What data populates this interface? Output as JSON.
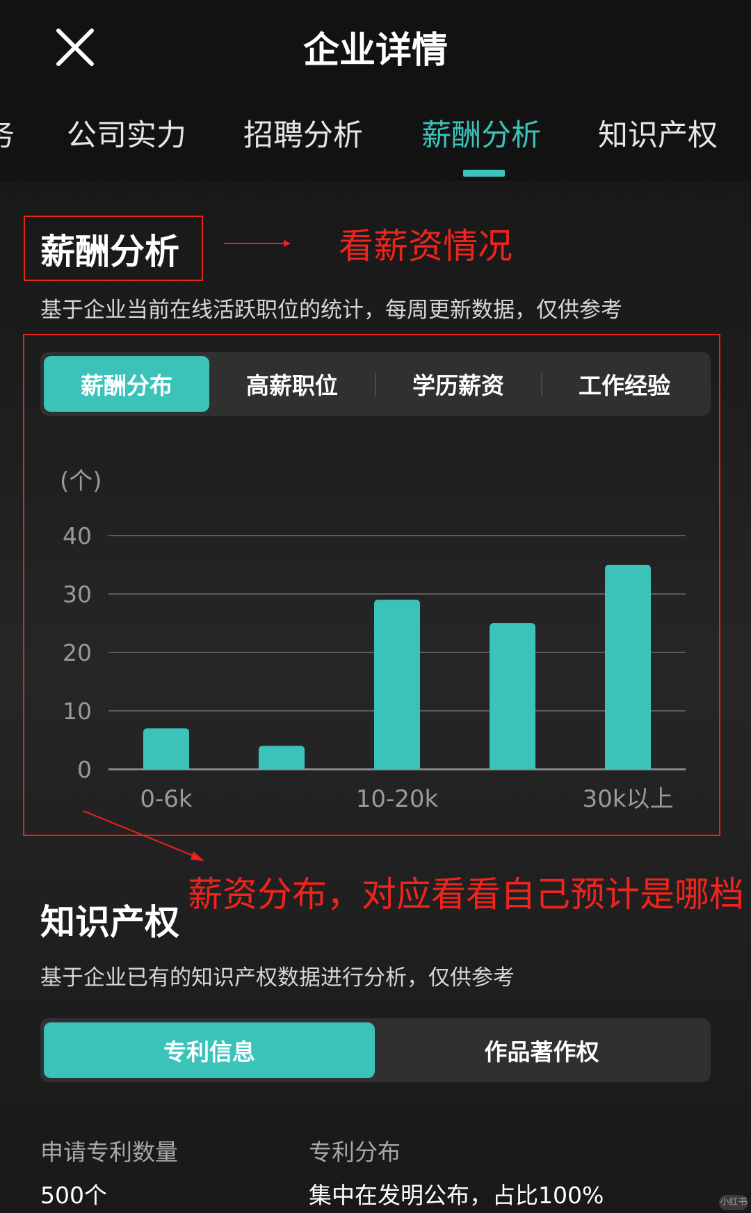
{
  "header": {
    "title": "企业详情",
    "tabs": [
      {
        "label": "务",
        "active": false
      },
      {
        "label": "公司实力",
        "active": false
      },
      {
        "label": "招聘分析",
        "active": false
      },
      {
        "label": "薪酬分析",
        "active": true
      },
      {
        "label": "知识产权",
        "active": false
      }
    ]
  },
  "salary": {
    "title": "薪酬分析",
    "desc": "基于企业当前在线活跃职位的统计，每周更新数据，仅供参考",
    "subtabs": [
      {
        "label": "薪酬分布",
        "active": true
      },
      {
        "label": "高薪职位",
        "active": false
      },
      {
        "label": "学历薪资",
        "active": false
      },
      {
        "label": "工作经验",
        "active": false
      }
    ]
  },
  "annotations": {
    "title_note": "看薪资情况",
    "chart_note": "薪资分布，对应看看自己预计是哪档"
  },
  "chart_data": {
    "type": "bar",
    "ylabel": "(个)",
    "ylim": [
      0,
      40
    ],
    "yticks": [
      0,
      10,
      20,
      30,
      40
    ],
    "categories": [
      "0-6k",
      "",
      "10-20k",
      "",
      "30k以上"
    ],
    "values": [
      7,
      4,
      29,
      25,
      35
    ],
    "grid": true,
    "bar_color": "#3cc3b9"
  },
  "ip": {
    "title": "知识产权",
    "desc": "基于企业已有的知识产权数据进行分析，仅供参考",
    "subtabs": [
      {
        "label": "专利信息",
        "active": true
      },
      {
        "label": "作品著作权",
        "active": false
      }
    ],
    "left_label": "申请专利数量",
    "left_value": "500个",
    "right_label": "专利分布",
    "right_value": "集中在发明公布，占比100%"
  },
  "watermark": "小红书",
  "colors": {
    "accent": "#3cc3b9",
    "annotation": "#e8221c",
    "background": "#1c1c1c"
  }
}
